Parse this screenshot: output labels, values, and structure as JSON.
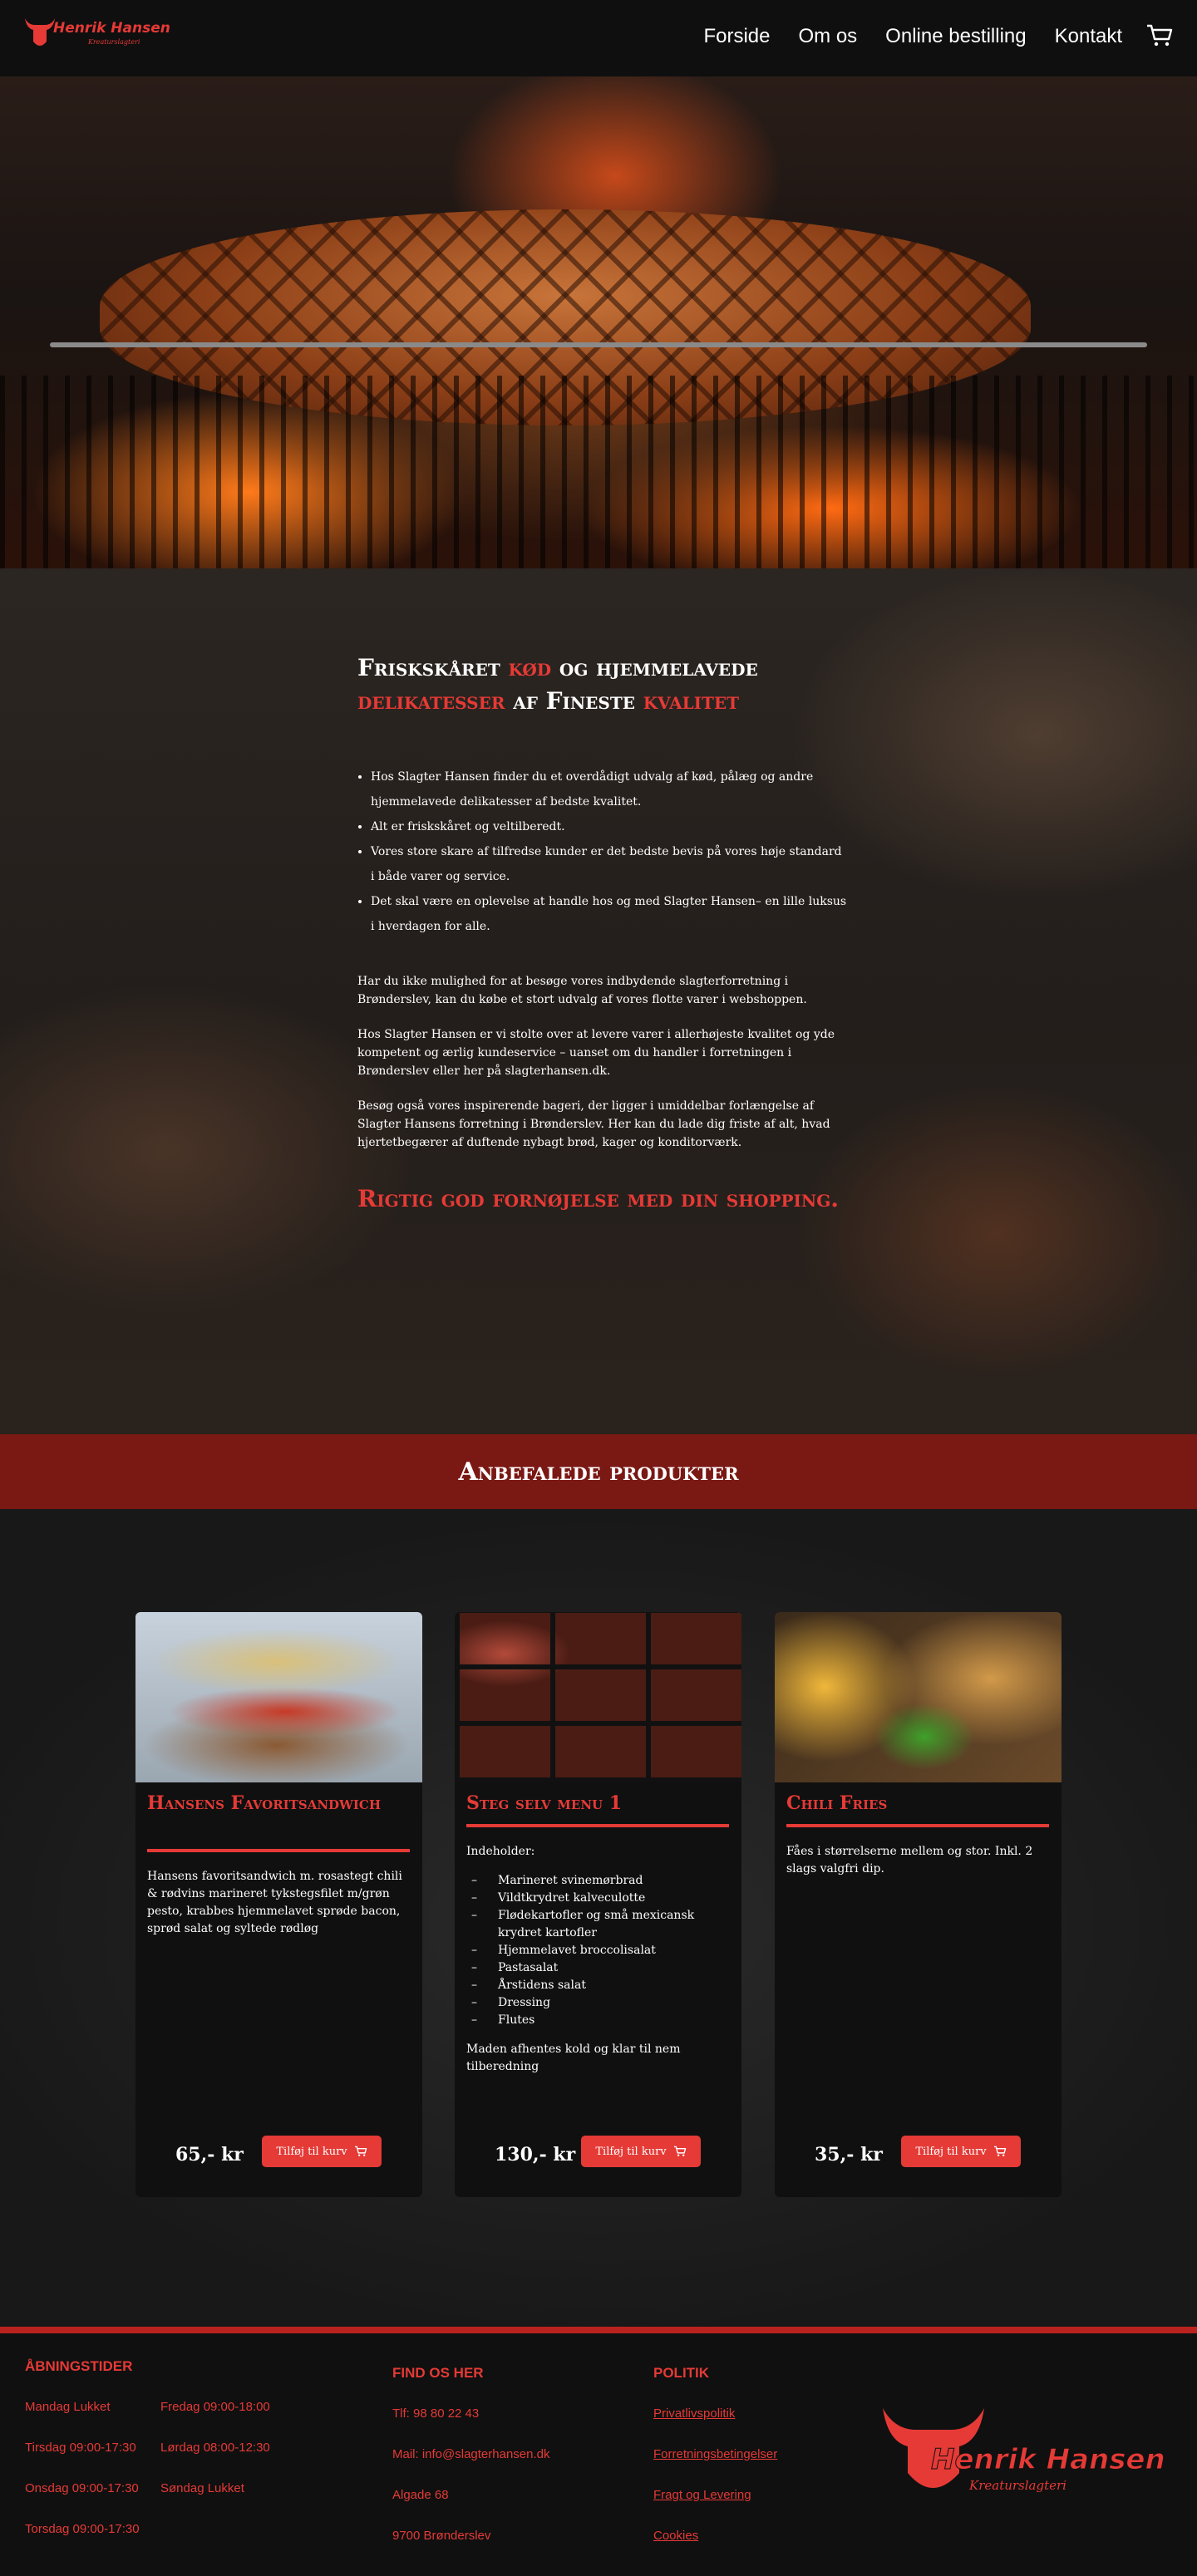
{
  "brand": {
    "name": "Henrik Hansen",
    "tagline": "Kreaturslagteri"
  },
  "nav": {
    "items": [
      {
        "label": "Forside"
      },
      {
        "label": "Om os"
      },
      {
        "label": "Online bestilling"
      },
      {
        "label": "Kontakt"
      }
    ]
  },
  "colors": {
    "accent": "#e53a36",
    "banner": "#7a1814",
    "background": "#151515"
  },
  "intro": {
    "heading_parts": [
      "Friskskåret ",
      "kød",
      " og hjemmelavede ",
      "delikatesser",
      " af Fineste ",
      "kvalitet"
    ],
    "bullets": [
      "Hos Slagter Hansen finder du et overdådigt udvalg af kød, pålæg og andre hjemmelavede delikatesser af bedste kvalitet.",
      "Alt er friskskåret og veltilberedt.",
      "Vores store skare af tilfredse kunder er det bedste bevis på vores høje standard i både varer og service.",
      "Det skal være en oplevelse at handle hos og med Slagter Hansen– en lille luksus i hverdagen for alle."
    ],
    "paragraphs": [
      "Har du ikke mulighed for at besøge vores indbydende slagterforretning i Brønderslev, kan du købe et stort udvalg af vores flotte varer i webshoppen.",
      "Hos Slagter Hansen er vi stolte over at levere varer i allerhøjeste kvalitet og yde kompetent og ærlig kundeservice – uanset om du handler i forretningen i Brønderslev eller her på slagterhansen.dk.",
      "Besøg også vores inspirerende bageri, der ligger i umiddelbar forlængelse af Slagter Hansens forretning i Brønderslev. Her kan du lade dig friste af alt, hvad hjertetbegærer af duftende nybagt brød, kager og konditorværk."
    ],
    "cta": "Rigtig god fornøjelse med din shopping."
  },
  "recommended": {
    "title": "Anbefalede produkter"
  },
  "products": [
    {
      "title": "Hansens Favoritsandwich",
      "description": "Hansens favoritsandwich m. rosastegt chili & rødvins marineret tykstegsfilet m/grøn pesto, krabbes hjemmelavet sprøde bacon, sprød salat og syltede rødløg",
      "price": "65,- kr",
      "button": "Tilføj til kurv"
    },
    {
      "title": "Steg selv menu 1",
      "intro": "Indeholder:",
      "items": [
        "Marineret svinemørbrad",
        "Vildtkrydret kalveculotte",
        "Flødekartofler og små mexicansk krydret kartofler",
        "Hjemmelavet broccolisalat",
        "Pastasalat",
        "Årstidens salat",
        "Dressing",
        "Flutes"
      ],
      "after": "Maden afhentes kold og klar til nem tilberedning",
      "price": "130,- kr",
      "button": "Tilføj til kurv"
    },
    {
      "title": "Chili Fries",
      "description": "Fåes i størrelserne mellem og stor. Inkl. 2 slags valgfri dip.",
      "price": "35,- kr",
      "button": "Tilføj til kurv"
    }
  ],
  "footer": {
    "hours_title": "ÅBNINGSTIDER",
    "hours": [
      "Mandag Lukket",
      "Tirsdag 09:00-17:30",
      "Onsdag 09:00-17:30",
      "Torsdag 09:00-17:30",
      "Fredag 09:00-18:00",
      "Lørdag 08:00-12:30",
      "Søndag Lukket"
    ],
    "find_title": "FIND OS HER",
    "find": [
      "Tlf: 98 80 22 43",
      "Mail: info@slagterhansen.dk",
      "Algade 68",
      "9700 Brønderslev"
    ],
    "policy_title": "POLITIK",
    "policy_links": [
      "Privatlivspolitik",
      "Forretningsbetingelser",
      "Fragt og Levering",
      "Cookies"
    ]
  },
  "icons": {
    "cart": "cart-icon",
    "logo": "bull-head-logo"
  }
}
